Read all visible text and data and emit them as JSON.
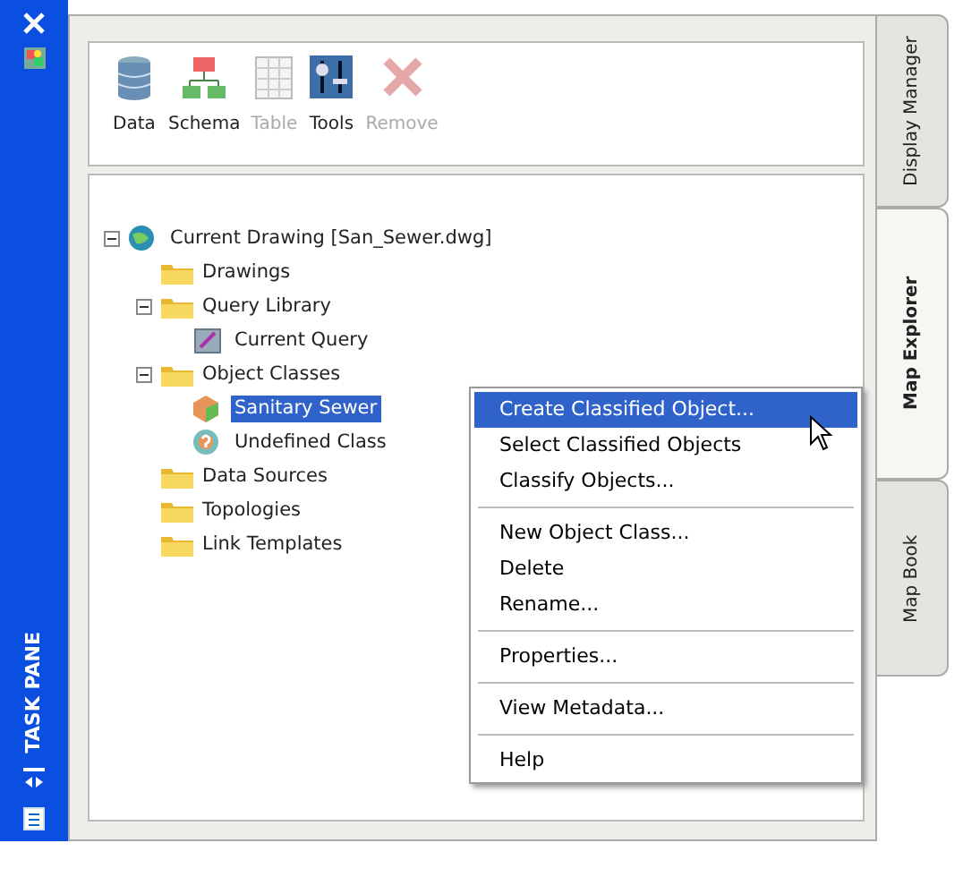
{
  "task_pane": {
    "title": "TASK PANE"
  },
  "toolbar": [
    {
      "label": "Data",
      "kind": "data",
      "disabled": false
    },
    {
      "label": "Schema",
      "kind": "schema",
      "disabled": false
    },
    {
      "label": "Table",
      "kind": "table",
      "disabled": true
    },
    {
      "label": "Tools",
      "kind": "tools",
      "disabled": false
    },
    {
      "label": "Remove",
      "kind": "remove",
      "disabled": true
    }
  ],
  "tree": [
    {
      "label": "Current Drawing [San_Sewer.dwg]",
      "kind": "drawing",
      "expanded": true,
      "selected": false,
      "children": [
        {
          "label": "Drawings",
          "kind": "folder",
          "selected": false
        },
        {
          "label": "Query Library",
          "kind": "folder",
          "expanded": true,
          "selected": false,
          "children": [
            {
              "label": "Current Query",
              "kind": "query",
              "selected": false
            }
          ]
        },
        {
          "label": "Object Classes",
          "kind": "folder",
          "expanded": true,
          "selected": false,
          "children": [
            {
              "label": "Sanitary Sewer",
              "kind": "class",
              "selected": true
            },
            {
              "label": "Undefined Class",
              "kind": "undefined",
              "selected": false
            }
          ]
        },
        {
          "label": "Data Sources",
          "kind": "folder",
          "selected": false
        },
        {
          "label": "Topologies",
          "kind": "folder",
          "selected": false
        },
        {
          "label": "Link Templates",
          "kind": "folder",
          "selected": false
        }
      ]
    }
  ],
  "context_menu": [
    {
      "kind": "item",
      "label": "Create Classified Object...",
      "selected": true
    },
    {
      "kind": "item",
      "label": "Select Classified Objects",
      "selected": false
    },
    {
      "kind": "item",
      "label": "Classify Objects...",
      "selected": false
    },
    {
      "kind": "separator"
    },
    {
      "kind": "item",
      "label": "New Object Class...",
      "selected": false
    },
    {
      "kind": "item",
      "label": "Delete",
      "selected": false
    },
    {
      "kind": "item",
      "label": "Rename...",
      "selected": false
    },
    {
      "kind": "separator"
    },
    {
      "kind": "item",
      "label": "Properties...",
      "selected": false
    },
    {
      "kind": "separator"
    },
    {
      "kind": "item",
      "label": "View Metadata...",
      "selected": false
    },
    {
      "kind": "separator"
    },
    {
      "kind": "item",
      "label": "Help",
      "selected": false
    }
  ],
  "side_tabs": [
    {
      "label": "Display Manager",
      "selected": false
    },
    {
      "label": "Map Explorer",
      "selected": true
    },
    {
      "label": "Map Book",
      "selected": false
    }
  ]
}
